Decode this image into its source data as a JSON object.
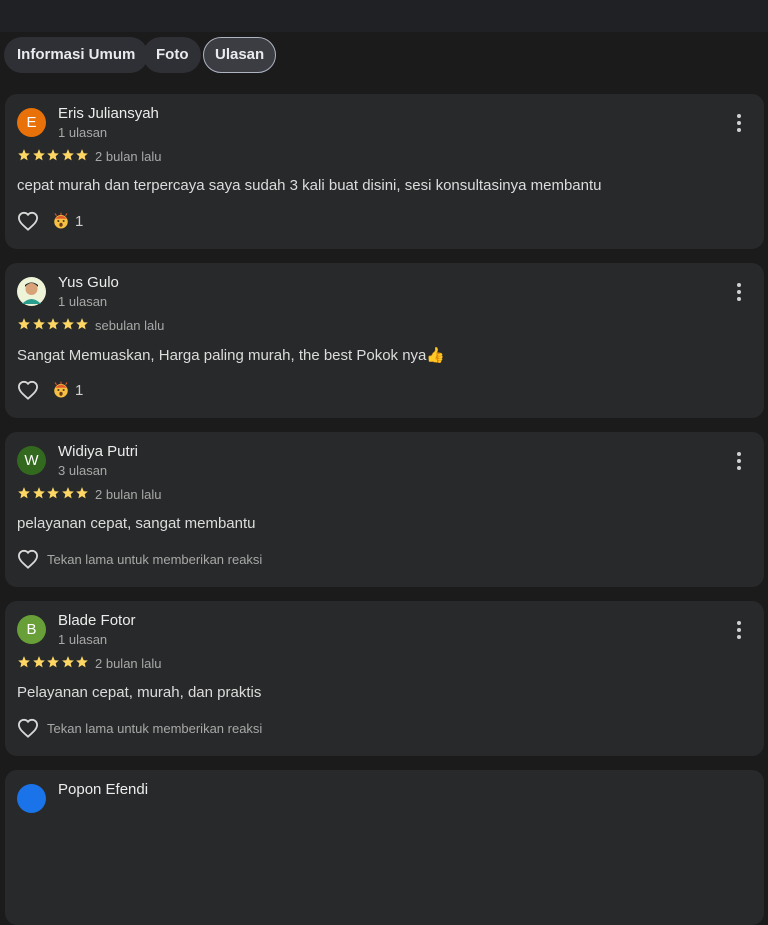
{
  "tabs": [
    {
      "label": "Informasi Umum",
      "active": false
    },
    {
      "label": "Foto",
      "active": false
    },
    {
      "label": "Ulasan",
      "active": true
    }
  ],
  "reviews": [
    {
      "initial": "E",
      "avatar_color": "#e8710a",
      "name": "Eris Juliansyah",
      "count": "1 ulasan",
      "rating": 5,
      "date": "2 bulan lalu",
      "text": "cepat murah dan terpercaya saya sudah 3 kali buat disini, sesi konsultasinya membantu",
      "reactions": "1",
      "reaction_icon": "mind-blown-emoji"
    },
    {
      "initial": "",
      "avatar_color": "#cfe8c9",
      "avatar_photo": true,
      "name": "Yus Gulo",
      "count": "1 ulasan",
      "rating": 5,
      "date": "sebulan lalu",
      "text": "Sangat Memuaskan, Harga paling murah, the best Pokok nya👍",
      "reactions": "1",
      "reaction_icon": "mind-blown-emoji"
    },
    {
      "initial": "W",
      "avatar_color": "#33691e",
      "name": "Widiya Putri",
      "count": "3 ulasan",
      "rating": 5,
      "date": "2 bulan lalu",
      "text": "pelayanan cepat, sangat membantu",
      "reaction_hint": "Tekan lama untuk memberikan reaksi"
    },
    {
      "initial": "B",
      "avatar_color": "#689f38",
      "name": "Blade Fotor",
      "count": "1 ulasan",
      "rating": 5,
      "date": "2 bulan lalu",
      "text": "Pelayanan cepat, murah, dan praktis",
      "reaction_hint": "Tekan lama untuk memberikan reaksi"
    },
    {
      "initial": "",
      "avatar_color": "#1a73e8",
      "name": "Popon Efendi"
    }
  ],
  "colors": {
    "star": "#fdd663",
    "card": "#28292a",
    "background": "#1b1b1c"
  }
}
